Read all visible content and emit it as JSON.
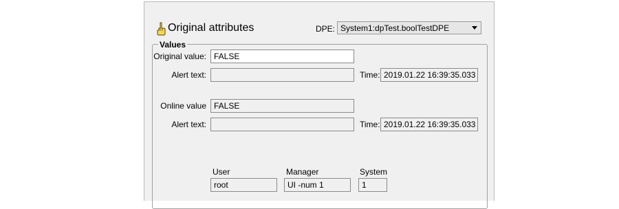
{
  "header": {
    "title": "Original attributes",
    "icon": "hand-pointer-icon",
    "dpe_label": "DPE:",
    "dpe_value": "System1:dpTest.boolTestDPE"
  },
  "values_group": {
    "title": "Values",
    "original_value_label": "Original value:",
    "original_value": "FALSE",
    "alert_text_label_1": "Alert text:",
    "alert_text_1": "",
    "time_label_1": "Time:",
    "time_1": "2019.01.22 16:39:35.033",
    "online_value_label": "Online value",
    "online_value": "FALSE",
    "alert_text_label_2": "Alert text:",
    "alert_text_2": "",
    "time_label_2": "Time:",
    "time_2": "2019.01.22 16:39:35.033",
    "user_label": "User",
    "user_value": "root",
    "manager_label": "Manager",
    "manager_value": "UI -num 1",
    "system_label": "System",
    "system_value": "1"
  }
}
